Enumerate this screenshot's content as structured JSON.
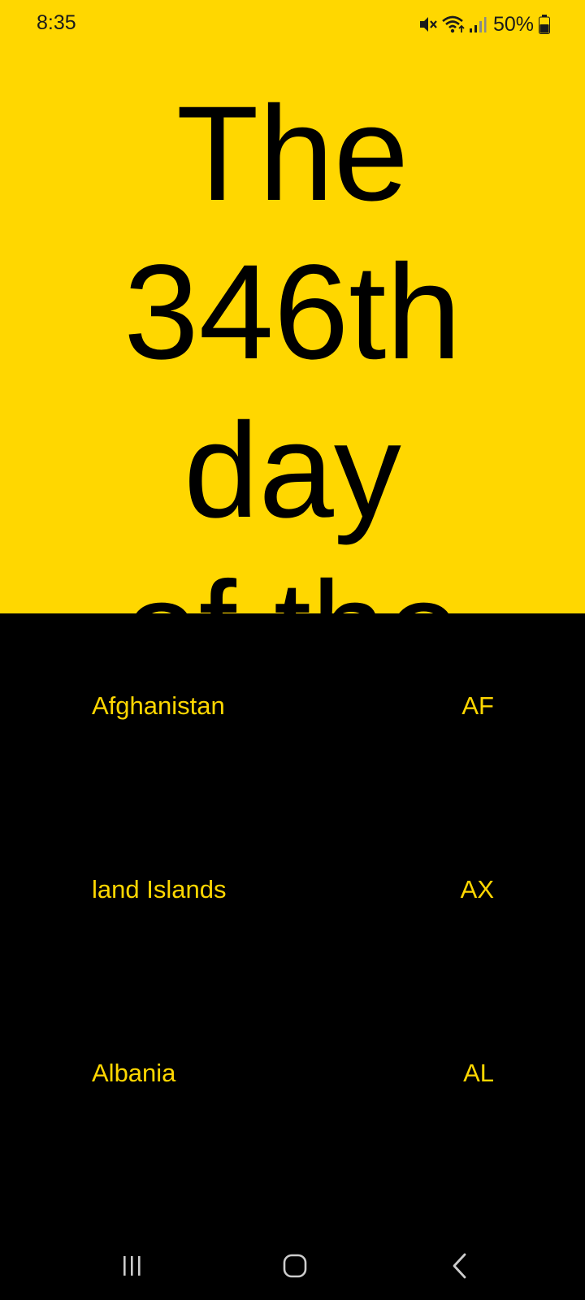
{
  "status_bar": {
    "time": "8:35",
    "battery": "50%",
    "icons": [
      "mute-icon",
      "wifi-icon",
      "signal-icon",
      "battery-icon"
    ]
  },
  "headline": {
    "line1": "The",
    "line2": "346th",
    "line3": "day",
    "line4": "of the"
  },
  "countries": [
    {
      "name": "Afghanistan",
      "code": "AF"
    },
    {
      "name": "land Islands",
      "code": "AX"
    },
    {
      "name": "Albania",
      "code": "AL"
    }
  ],
  "nav": {
    "icons": [
      "recent-apps-icon",
      "home-icon",
      "back-icon"
    ]
  },
  "colors": {
    "accent": "#FFD700",
    "background": "#000000",
    "text_dark": "#000000"
  }
}
